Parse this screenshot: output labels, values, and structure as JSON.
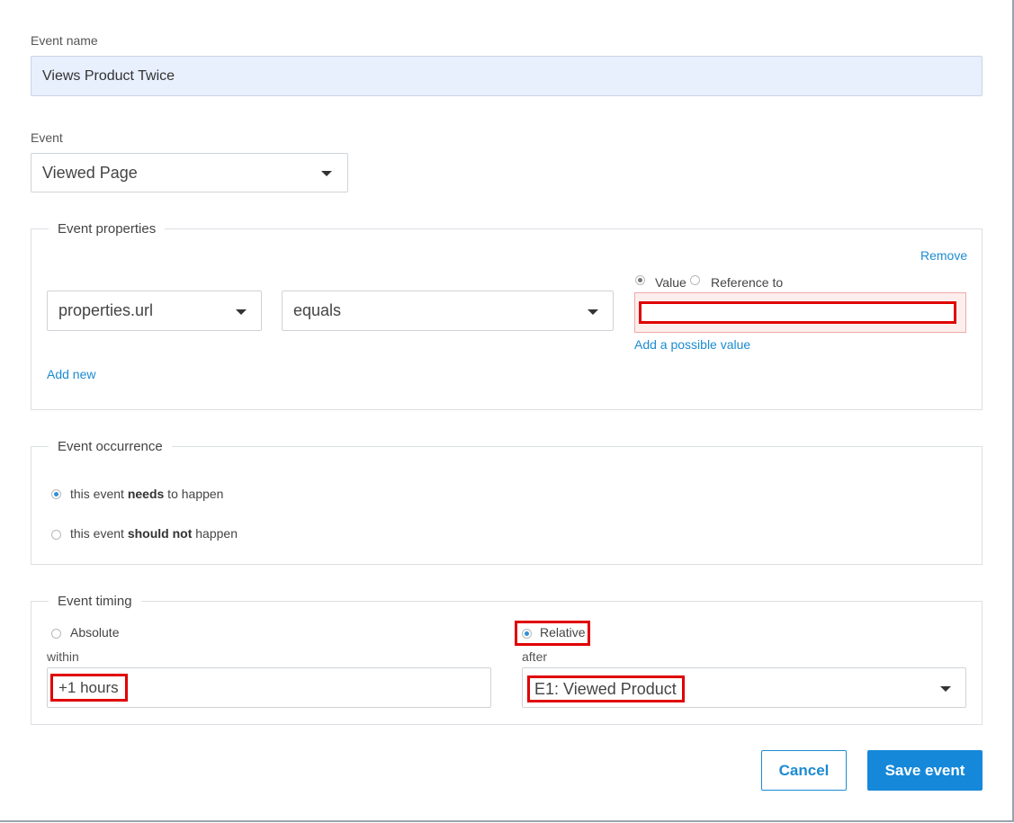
{
  "event_name": {
    "label": "Event name",
    "value": "Views Product Twice"
  },
  "event": {
    "label": "Event",
    "selected": "Viewed Page"
  },
  "properties": {
    "legend": "Event properties",
    "remove_label": "Remove",
    "property_selected": "properties.url",
    "operator_selected": "equals",
    "value_radio_label": "Value",
    "reference_radio_label": "Reference to",
    "value_input": "",
    "add_possible_value_label": "Add a possible value",
    "add_new_label": "Add new"
  },
  "occurrence": {
    "legend": "Event occurrence",
    "option1_pre": "this event ",
    "option1_bold": "needs",
    "option1_post": " to happen",
    "option2_pre": "this event ",
    "option2_bold": "should not",
    "option2_post": " happen"
  },
  "timing": {
    "legend": "Event timing",
    "absolute_label": "Absolute",
    "relative_label": "Relative",
    "within_label": "within",
    "within_value": "+1 hours",
    "after_label": "after",
    "after_selected": "E1: Viewed Product"
  },
  "buttons": {
    "cancel_label": "Cancel",
    "save_label": "Save event"
  },
  "colors": {
    "accent": "#1588d9",
    "highlight": "#e00000",
    "name_field_bg": "#e8f0fd",
    "error_bg": "#fdeeee"
  },
  "icons": [
    "chevron-down-icon",
    "radio-icon"
  ]
}
